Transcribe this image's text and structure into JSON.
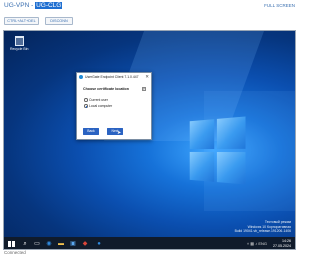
{
  "header": {
    "title_prefix": "UG-VPN",
    "title_sep": " - ",
    "title_highlight": "UG-CLG",
    "fullscreen_label": "FULL SCREEN"
  },
  "toolbar": {
    "cad_label": "CTRL+ALT+DEL",
    "disconnect_label": "DISCONN"
  },
  "desktop": {
    "recycle_bin_label": "Recycle Bin"
  },
  "dialog": {
    "title": "UserGate Endpoint Client 7.1.0.447",
    "close_glyph": "✕",
    "heading": "Choose certificate location",
    "help_glyph": "?",
    "options": [
      {
        "label": "Current user",
        "checked": false
      },
      {
        "label": "Local computer",
        "checked": true
      }
    ],
    "back_label": "Back",
    "next_label": "Next"
  },
  "watermark": {
    "line1": "Тестовый режим",
    "line2": "Windows 10 Корпоративная",
    "line3": "Build 19041.vb_release.191206-1406"
  },
  "taskbar": {
    "search_icon": "search-icon",
    "time": "14:26",
    "date": "27.05.2024",
    "lang": "ENG"
  },
  "status": {
    "text": "Connected"
  }
}
